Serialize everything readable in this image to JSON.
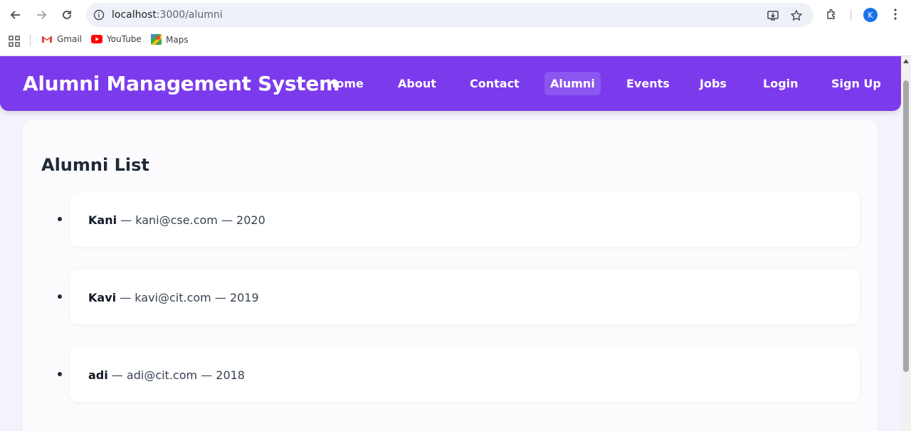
{
  "browser": {
    "url_host": "localhost",
    "url_path": ":3000/alumni",
    "profile_initial": "K",
    "bookmarks": [
      {
        "label": "Gmail",
        "icon": "gmail-icon"
      },
      {
        "label": "YouTube",
        "icon": "youtube-icon"
      },
      {
        "label": "Maps",
        "icon": "maps-icon"
      }
    ]
  },
  "navbar": {
    "brand": "Alumni Management System",
    "links": [
      "Home",
      "About",
      "Contact",
      "Alumni",
      "Events",
      "Jobs",
      "Login",
      "Sign Up"
    ],
    "active": "Alumni"
  },
  "main": {
    "title": "Alumni List",
    "alumni": [
      {
        "name": "Kani",
        "email": "kani@cse.com",
        "year": "2020"
      },
      {
        "name": "Kavi",
        "email": "kavi@cit.com",
        "year": "2019"
      },
      {
        "name": "adi",
        "email": "adi@cit.com",
        "year": "2018"
      }
    ]
  },
  "colors": {
    "navbar": "#7c3aed",
    "active_link_bg": "#8b55f0",
    "page_bg": "#f4f2fb"
  }
}
